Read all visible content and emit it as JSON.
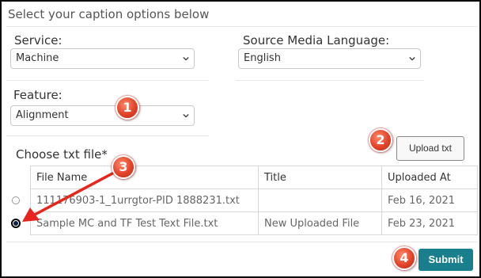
{
  "header": {
    "title": "Select your caption options below"
  },
  "service": {
    "label": "Service:",
    "value": "Machine"
  },
  "source_language": {
    "label": "Source Media Language:",
    "value": "English"
  },
  "feature": {
    "label": "Feature:",
    "value": "Alignment"
  },
  "file_section": {
    "label": "Choose txt file*",
    "upload_label": "Upload txt"
  },
  "table": {
    "columns": [
      "File Name",
      "Title",
      "Uploaded At"
    ],
    "rows": [
      {
        "file_name": "111176903-1_1urrgtor-PID 1888231.txt",
        "title": "",
        "uploaded_at": "Feb 16, 2021",
        "selected": false
      },
      {
        "file_name": "Sample MC and TF Test Text File.txt",
        "title": "New Uploaded File",
        "uploaded_at": "Feb 23, 2021",
        "selected": true
      }
    ]
  },
  "submit": {
    "label": "Submit"
  },
  "badges": [
    "1",
    "2",
    "3",
    "4"
  ],
  "colors": {
    "submit_bg": "#1a7f8c",
    "badge": "#e2432a",
    "arrow": "#e8251c",
    "radio_selected": "#0b2240"
  }
}
